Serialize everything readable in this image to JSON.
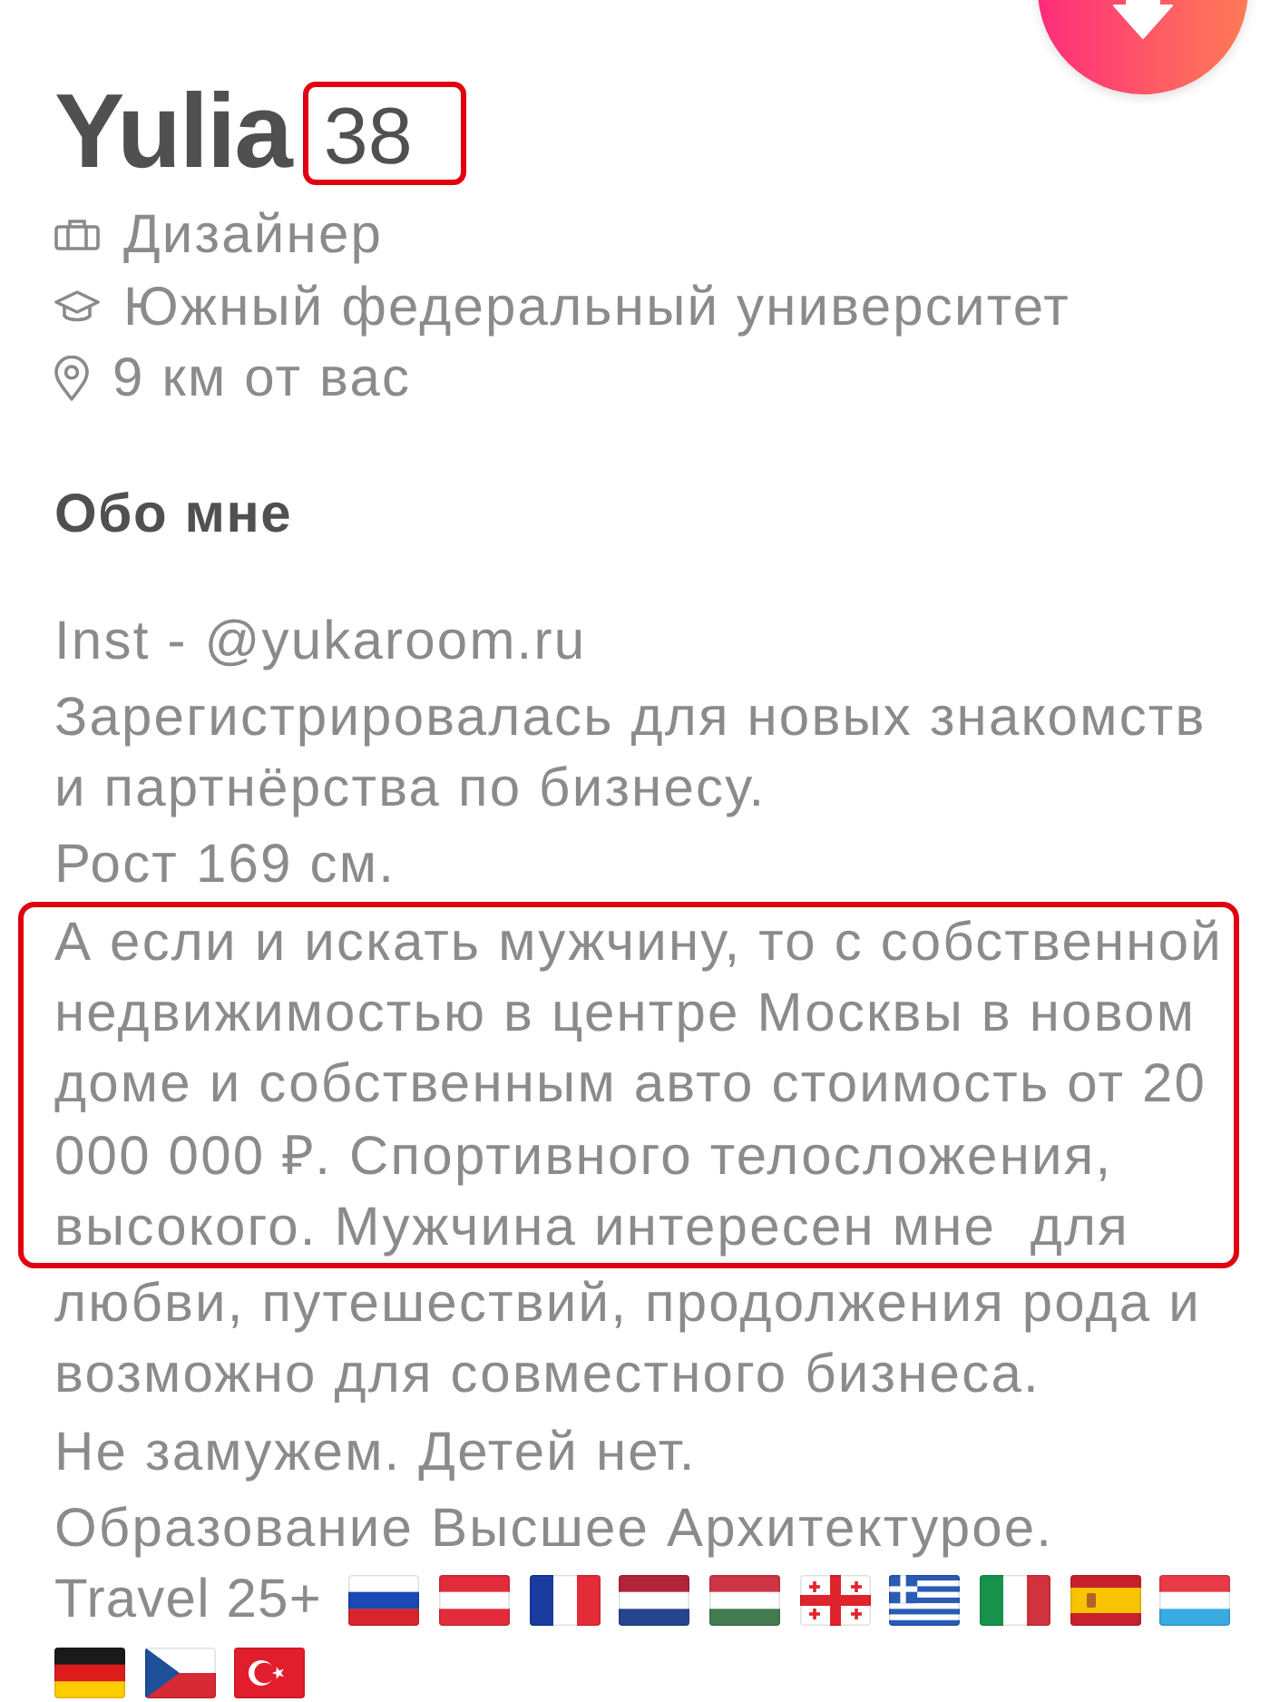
{
  "profile": {
    "name": "Yulia",
    "age": {
      "text": "38",
      "highlighted": true
    }
  },
  "details": [
    {
      "kind": "job",
      "text": "Дизайнер"
    },
    {
      "kind": "school",
      "text": "Южный федеральный университет"
    },
    {
      "kind": "location",
      "text": "9 км от вас"
    }
  ],
  "about": {
    "title": "Обо мне",
    "paragraphs": [
      {
        "text": "Inst - @yukaroom.ru",
        "highlighted": false
      },
      {
        "text": "Зарегистрировалась для новых знакомств и партнёрства по бизнесу.",
        "highlighted": false
      },
      {
        "text": "Рост 169 см.",
        "highlighted": false
      },
      {
        "text": "А если и искать мужчину, то с собственной недвижимостью в центре Москвы в новом доме и собственным авто стоимость от 20 000 000 ₽. Спортивного телосложения, высокого. Мужчина интересен мне  для",
        "highlighted": true
      },
      {
        "text": "любви, путешествий, продолжения рода и возможно для совместного бизнеса.",
        "highlighted": false
      },
      {
        "text": "Не замужем. Детей нет.",
        "highlighted": false
      },
      {
        "text": "Образование Высшее Архитектурое.",
        "highlighted": false
      }
    ]
  },
  "travel": {
    "label": "Travel 25+",
    "flags": [
      {
        "kind": "ru"
      },
      {
        "kind": "at"
      },
      {
        "kind": "fr"
      },
      {
        "kind": "nl"
      },
      {
        "kind": "hu"
      },
      {
        "kind": "ge"
      },
      {
        "kind": "gr"
      },
      {
        "kind": "it"
      },
      {
        "kind": "es"
      },
      {
        "kind": "lu"
      },
      {
        "kind": "de"
      },
      {
        "kind": "cz"
      },
      {
        "kind": "tr"
      }
    ]
  }
}
